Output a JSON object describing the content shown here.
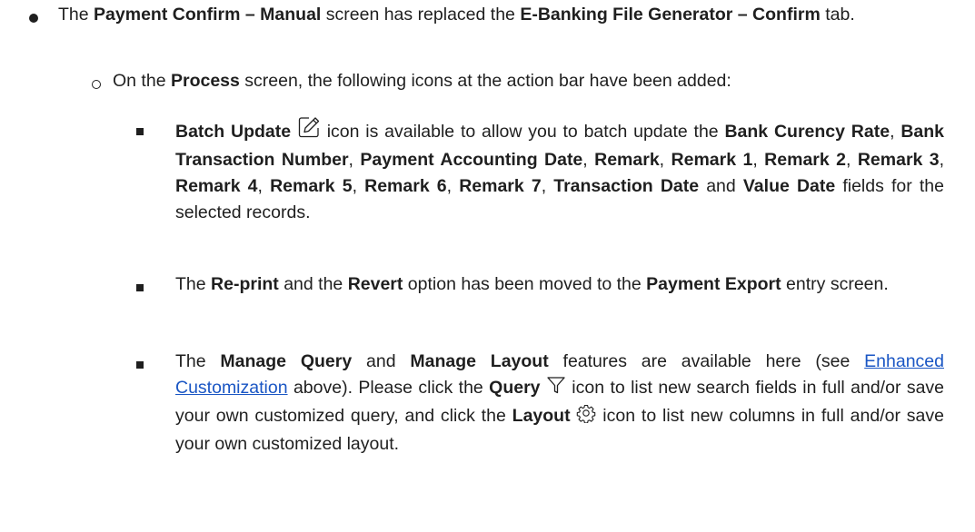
{
  "bullet1": {
    "pre": "The ",
    "b1": "Payment Confirm – Manual",
    "mid": " screen has replaced the ",
    "b2": "E-Banking File Generator – Confirm",
    "post": " tab."
  },
  "sub1": {
    "pre": "On the ",
    "b1": "Process",
    "post": " screen, the following icons at the action bar have been added:"
  },
  "item1": {
    "b_batch": "Batch Update",
    "icon_name": "edit-pencil-icon",
    "t1": " icon is available to allow you to batch update the ",
    "f1": "Bank Curency Rate",
    "c1": ", ",
    "f2": "Bank Transaction Number",
    "c2": ", ",
    "f3": "Payment Accounting Date",
    "c3": ", ",
    "f4": "Remark",
    "c4": ", ",
    "f5": "Remark 1",
    "c5": ", ",
    "f6": "Remark 2",
    "c6": ", ",
    "f7": "Remark 3",
    "c7": ", ",
    "f8": "Remark 4",
    "c8": ", ",
    "f9": "Remark 5",
    "c9": ", ",
    "f10": "Remark 6",
    "c10": ", ",
    "f11": "Remark 7",
    "c11": ", ",
    "f12": "Transaction Date",
    "and": " and ",
    "f13": "Value Date",
    "end": " fields for the selected records."
  },
  "item2": {
    "pre": "The ",
    "b1": "Re-print",
    "mid": " and the ",
    "b2": "Revert",
    "mid2": " option has been moved to the ",
    "b3": "Payment Export",
    "post": " entry screen."
  },
  "item3": {
    "pre": "The ",
    "b1": "Manage Query",
    "and": " and ",
    "b2": "Manage Layout",
    "mid": " features are available here (see ",
    "link": "Enhanced Customization",
    "mid2": " above). Please click the ",
    "b3": "Query",
    "icon1_name": "filter-funnel-icon",
    "mid3": " icon to list new search fields in full and/or save your own customized query, and click the ",
    "b4": "Layout",
    "icon2_name": "gear-icon",
    "post": " icon to list new columns in full and/or save your own customized layout."
  },
  "colors": {
    "text": "#1f1f1f",
    "link": "#1a56c4"
  }
}
